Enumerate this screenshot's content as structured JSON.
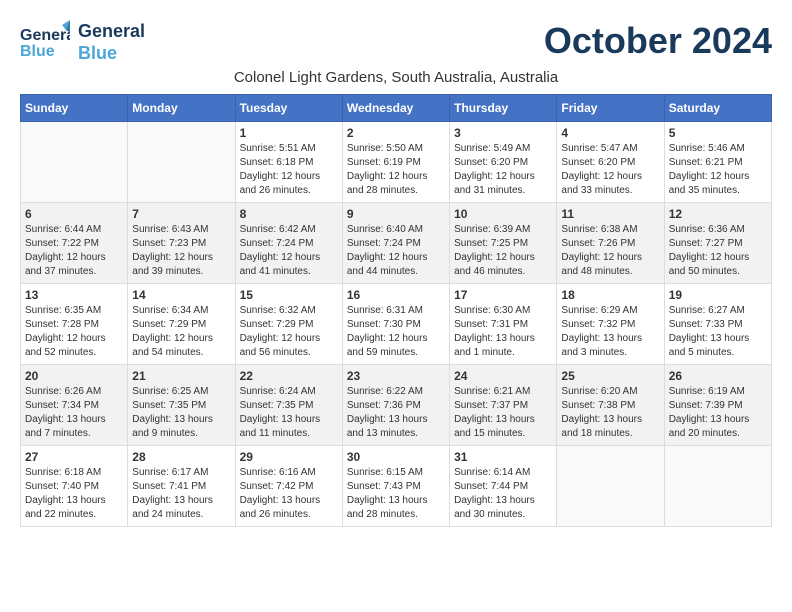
{
  "logo": {
    "line1": "General",
    "line2": "Blue"
  },
  "title": "October 2024",
  "subtitle": "Colonel Light Gardens, South Australia, Australia",
  "days_header": [
    "Sunday",
    "Monday",
    "Tuesday",
    "Wednesday",
    "Thursday",
    "Friday",
    "Saturday"
  ],
  "weeks": [
    {
      "cells": [
        {
          "empty": true
        },
        {
          "empty": true
        },
        {
          "num": "1",
          "sunrise": "5:51 AM",
          "sunset": "6:18 PM",
          "daylight": "12 hours and 26 minutes."
        },
        {
          "num": "2",
          "sunrise": "5:50 AM",
          "sunset": "6:19 PM",
          "daylight": "12 hours and 28 minutes."
        },
        {
          "num": "3",
          "sunrise": "5:49 AM",
          "sunset": "6:20 PM",
          "daylight": "12 hours and 31 minutes."
        },
        {
          "num": "4",
          "sunrise": "5:47 AM",
          "sunset": "6:20 PM",
          "daylight": "12 hours and 33 minutes."
        },
        {
          "num": "5",
          "sunrise": "5:46 AM",
          "sunset": "6:21 PM",
          "daylight": "12 hours and 35 minutes."
        }
      ]
    },
    {
      "cells": [
        {
          "num": "6",
          "sunrise": "6:44 AM",
          "sunset": "7:22 PM",
          "daylight": "12 hours and 37 minutes."
        },
        {
          "num": "7",
          "sunrise": "6:43 AM",
          "sunset": "7:23 PM",
          "daylight": "12 hours and 39 minutes."
        },
        {
          "num": "8",
          "sunrise": "6:42 AM",
          "sunset": "7:24 PM",
          "daylight": "12 hours and 41 minutes."
        },
        {
          "num": "9",
          "sunrise": "6:40 AM",
          "sunset": "7:24 PM",
          "daylight": "12 hours and 44 minutes."
        },
        {
          "num": "10",
          "sunrise": "6:39 AM",
          "sunset": "7:25 PM",
          "daylight": "12 hours and 46 minutes."
        },
        {
          "num": "11",
          "sunrise": "6:38 AM",
          "sunset": "7:26 PM",
          "daylight": "12 hours and 48 minutes."
        },
        {
          "num": "12",
          "sunrise": "6:36 AM",
          "sunset": "7:27 PM",
          "daylight": "12 hours and 50 minutes."
        }
      ]
    },
    {
      "cells": [
        {
          "num": "13",
          "sunrise": "6:35 AM",
          "sunset": "7:28 PM",
          "daylight": "12 hours and 52 minutes."
        },
        {
          "num": "14",
          "sunrise": "6:34 AM",
          "sunset": "7:29 PM",
          "daylight": "12 hours and 54 minutes."
        },
        {
          "num": "15",
          "sunrise": "6:32 AM",
          "sunset": "7:29 PM",
          "daylight": "12 hours and 56 minutes."
        },
        {
          "num": "16",
          "sunrise": "6:31 AM",
          "sunset": "7:30 PM",
          "daylight": "12 hours and 59 minutes."
        },
        {
          "num": "17",
          "sunrise": "6:30 AM",
          "sunset": "7:31 PM",
          "daylight": "13 hours and 1 minute."
        },
        {
          "num": "18",
          "sunrise": "6:29 AM",
          "sunset": "7:32 PM",
          "daylight": "13 hours and 3 minutes."
        },
        {
          "num": "19",
          "sunrise": "6:27 AM",
          "sunset": "7:33 PM",
          "daylight": "13 hours and 5 minutes."
        }
      ]
    },
    {
      "cells": [
        {
          "num": "20",
          "sunrise": "6:26 AM",
          "sunset": "7:34 PM",
          "daylight": "13 hours and 7 minutes."
        },
        {
          "num": "21",
          "sunrise": "6:25 AM",
          "sunset": "7:35 PM",
          "daylight": "13 hours and 9 minutes."
        },
        {
          "num": "22",
          "sunrise": "6:24 AM",
          "sunset": "7:35 PM",
          "daylight": "13 hours and 11 minutes."
        },
        {
          "num": "23",
          "sunrise": "6:22 AM",
          "sunset": "7:36 PM",
          "daylight": "13 hours and 13 minutes."
        },
        {
          "num": "24",
          "sunrise": "6:21 AM",
          "sunset": "7:37 PM",
          "daylight": "13 hours and 15 minutes."
        },
        {
          "num": "25",
          "sunrise": "6:20 AM",
          "sunset": "7:38 PM",
          "daylight": "13 hours and 18 minutes."
        },
        {
          "num": "26",
          "sunrise": "6:19 AM",
          "sunset": "7:39 PM",
          "daylight": "13 hours and 20 minutes."
        }
      ]
    },
    {
      "cells": [
        {
          "num": "27",
          "sunrise": "6:18 AM",
          "sunset": "7:40 PM",
          "daylight": "13 hours and 22 minutes."
        },
        {
          "num": "28",
          "sunrise": "6:17 AM",
          "sunset": "7:41 PM",
          "daylight": "13 hours and 24 minutes."
        },
        {
          "num": "29",
          "sunrise": "6:16 AM",
          "sunset": "7:42 PM",
          "daylight": "13 hours and 26 minutes."
        },
        {
          "num": "30",
          "sunrise": "6:15 AM",
          "sunset": "7:43 PM",
          "daylight": "13 hours and 28 minutes."
        },
        {
          "num": "31",
          "sunrise": "6:14 AM",
          "sunset": "7:44 PM",
          "daylight": "13 hours and 30 minutes."
        },
        {
          "empty": true
        },
        {
          "empty": true
        }
      ]
    }
  ]
}
